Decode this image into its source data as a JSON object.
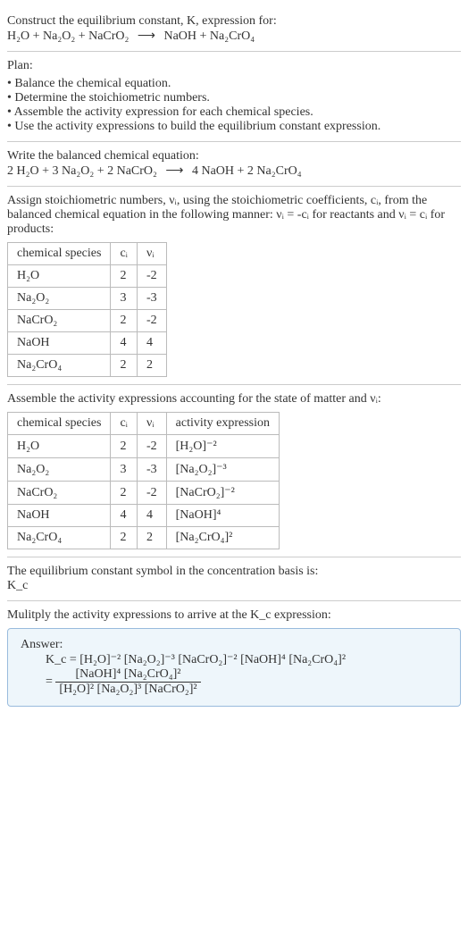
{
  "header": {
    "prompt": "Construct the equilibrium constant, K, expression for:",
    "equation_lhs": "H₂O + Na₂O₂ + NaCrO₂",
    "arrow": "⟶",
    "equation_rhs": "NaOH + Na₂CrO₄"
  },
  "plan": {
    "title": "Plan:",
    "items": [
      "Balance the chemical equation.",
      "Determine the stoichiometric numbers.",
      "Assemble the activity expression for each chemical species.",
      "Use the activity expressions to build the equilibrium constant expression."
    ]
  },
  "balanced": {
    "title": "Write the balanced chemical equation:",
    "lhs": "2 H₂O + 3 Na₂O₂ + 2 NaCrO₂",
    "arrow": "⟶",
    "rhs": "4 NaOH + 2 Na₂CrO₄"
  },
  "stoich": {
    "intro_a": "Assign stoichiometric numbers, νᵢ, using the stoichiometric coefficients, cᵢ, from the balanced chemical equation in the following manner: νᵢ = -cᵢ for reactants and νᵢ = cᵢ for products:",
    "headers": {
      "species": "chemical species",
      "ci": "cᵢ",
      "vi": "νᵢ"
    },
    "rows": [
      {
        "species": "H₂O",
        "ci": "2",
        "vi": "-2"
      },
      {
        "species": "Na₂O₂",
        "ci": "3",
        "vi": "-3"
      },
      {
        "species": "NaCrO₂",
        "ci": "2",
        "vi": "-2"
      },
      {
        "species": "NaOH",
        "ci": "4",
        "vi": "4"
      },
      {
        "species": "Na₂CrO₄",
        "ci": "2",
        "vi": "2"
      }
    ]
  },
  "activity": {
    "intro": "Assemble the activity expressions accounting for the state of matter and νᵢ:",
    "headers": {
      "species": "chemical species",
      "ci": "cᵢ",
      "vi": "νᵢ",
      "expr": "activity expression"
    },
    "rows": [
      {
        "species": "H₂O",
        "ci": "2",
        "vi": "-2",
        "expr": "[H₂O]⁻²"
      },
      {
        "species": "Na₂O₂",
        "ci": "3",
        "vi": "-3",
        "expr": "[Na₂O₂]⁻³"
      },
      {
        "species": "NaCrO₂",
        "ci": "2",
        "vi": "-2",
        "expr": "[NaCrO₂]⁻²"
      },
      {
        "species": "NaOH",
        "ci": "4",
        "vi": "4",
        "expr": "[NaOH]⁴"
      },
      {
        "species": "Na₂CrO₄",
        "ci": "2",
        "vi": "2",
        "expr": "[Na₂CrO₄]²"
      }
    ]
  },
  "kc_symbol": {
    "line1": "The equilibrium constant symbol in the concentration basis is:",
    "line2": "K_c"
  },
  "multiply": {
    "title": "Mulitply the activity expressions to arrive at the K_c expression:"
  },
  "answer": {
    "label": "Answer:",
    "line1": "K_c = [H₂O]⁻² [Na₂O₂]⁻³ [NaCrO₂]⁻² [NaOH]⁴ [Na₂CrO₄]²",
    "frac_num": "[NaOH]⁴ [Na₂CrO₄]²",
    "frac_den": "[H₂O]² [Na₂O₂]³ [NaCrO₂]²",
    "equals": "= "
  }
}
